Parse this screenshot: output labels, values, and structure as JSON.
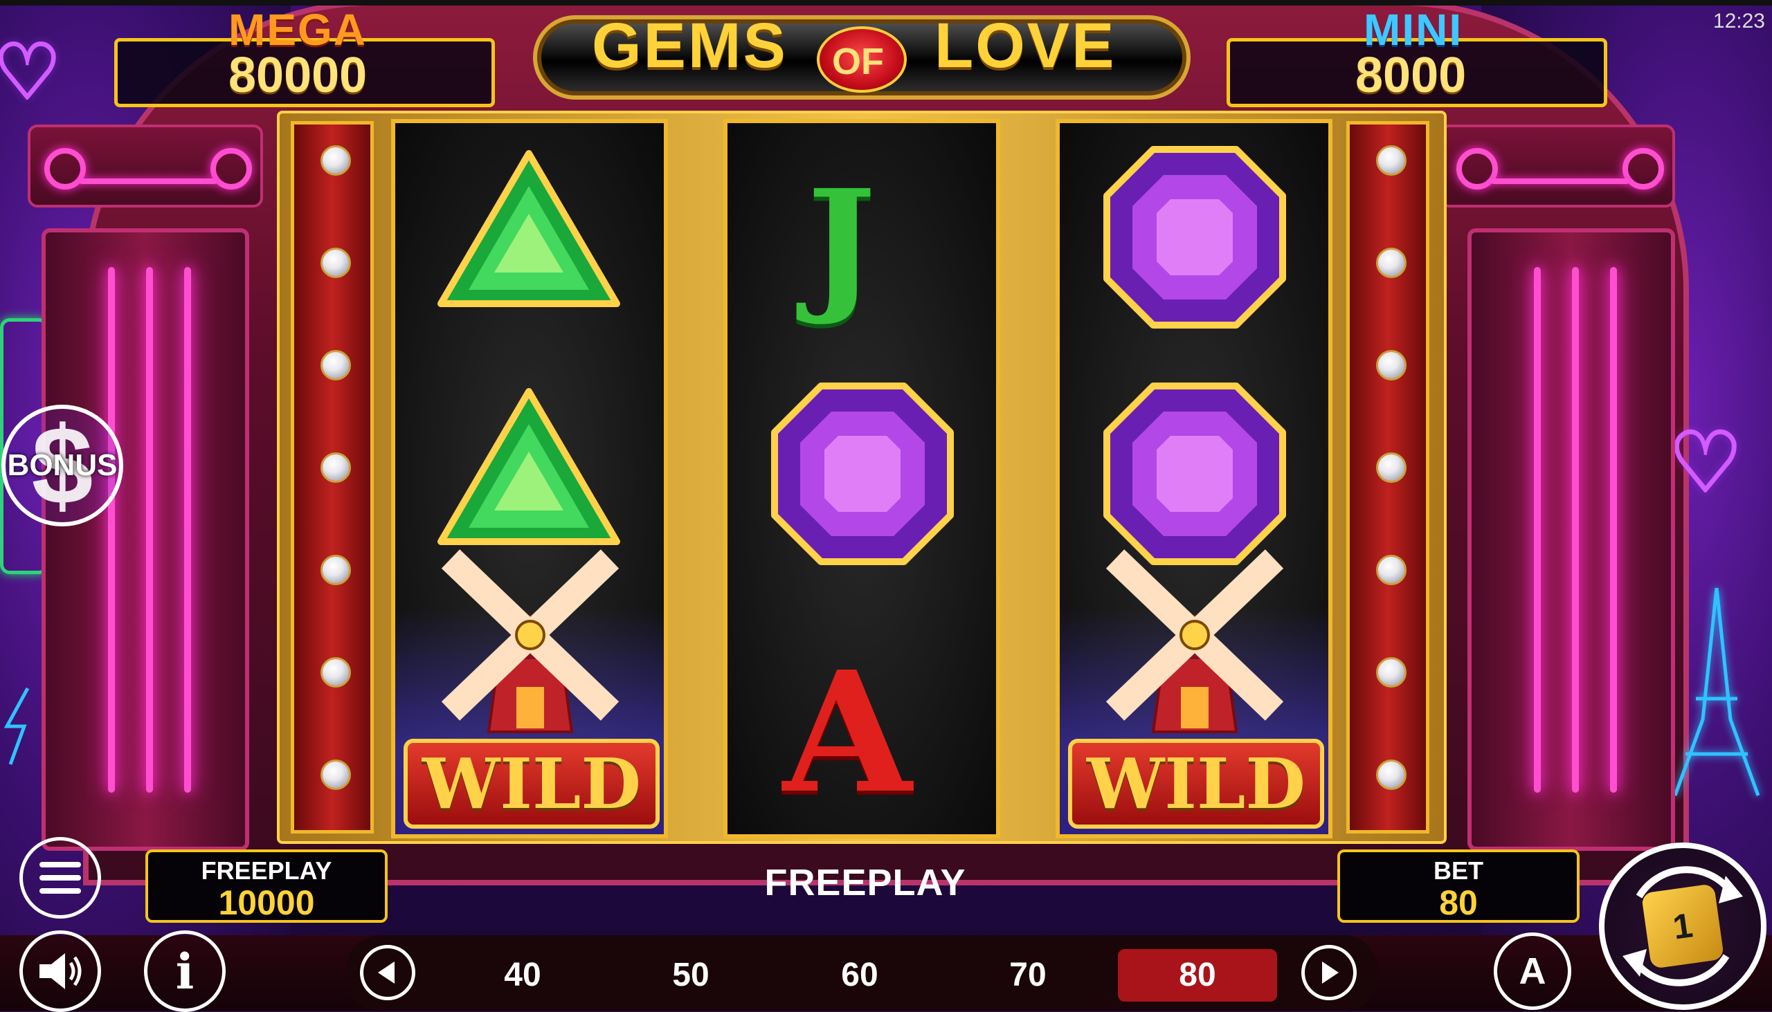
{
  "status": {
    "time": "12:23"
  },
  "title": {
    "word1": "GEMS",
    "word2": "OF",
    "word3": "LOVE"
  },
  "jackpots": {
    "mega": {
      "label": "MEGA",
      "value": "80000"
    },
    "mini": {
      "label": "MINI",
      "value": "8000"
    }
  },
  "bonus": {
    "label": "BONUS",
    "symbol": "$"
  },
  "reels": [
    {
      "symbols": [
        "green-gem",
        "green-gem",
        "wild-windmill"
      ],
      "wild_label": "WILD"
    },
    {
      "symbols": [
        "J",
        "purple-gem",
        "A"
      ],
      "letters": {
        "top": "J",
        "bottom": "A"
      }
    },
    {
      "symbols": [
        "purple-gem",
        "purple-gem",
        "wild-windmill"
      ],
      "wild_label": "WILD"
    }
  ],
  "freeplay_panel": {
    "label": "FREEPLAY",
    "value": "10000"
  },
  "center_status": "FREEPLAY",
  "bet_panel": {
    "label": "BET",
    "value": "80"
  },
  "bet_options": [
    "40",
    "50",
    "60",
    "70",
    "80"
  ],
  "selected_bet": "80",
  "controls": {
    "menu_icon": "hamburger-menu-icon",
    "sound_icon": "speaker-icon",
    "info_icon": "info-icon",
    "prev_icon": "chevron-left-icon",
    "next_icon": "chevron-right-icon",
    "autoplay_label": "A",
    "spin_label": "1"
  },
  "colors": {
    "gold": "#f5c518",
    "mega": "#ff9a1f",
    "mini": "#3ec8ff",
    "selected_bet": "#a8141a"
  }
}
